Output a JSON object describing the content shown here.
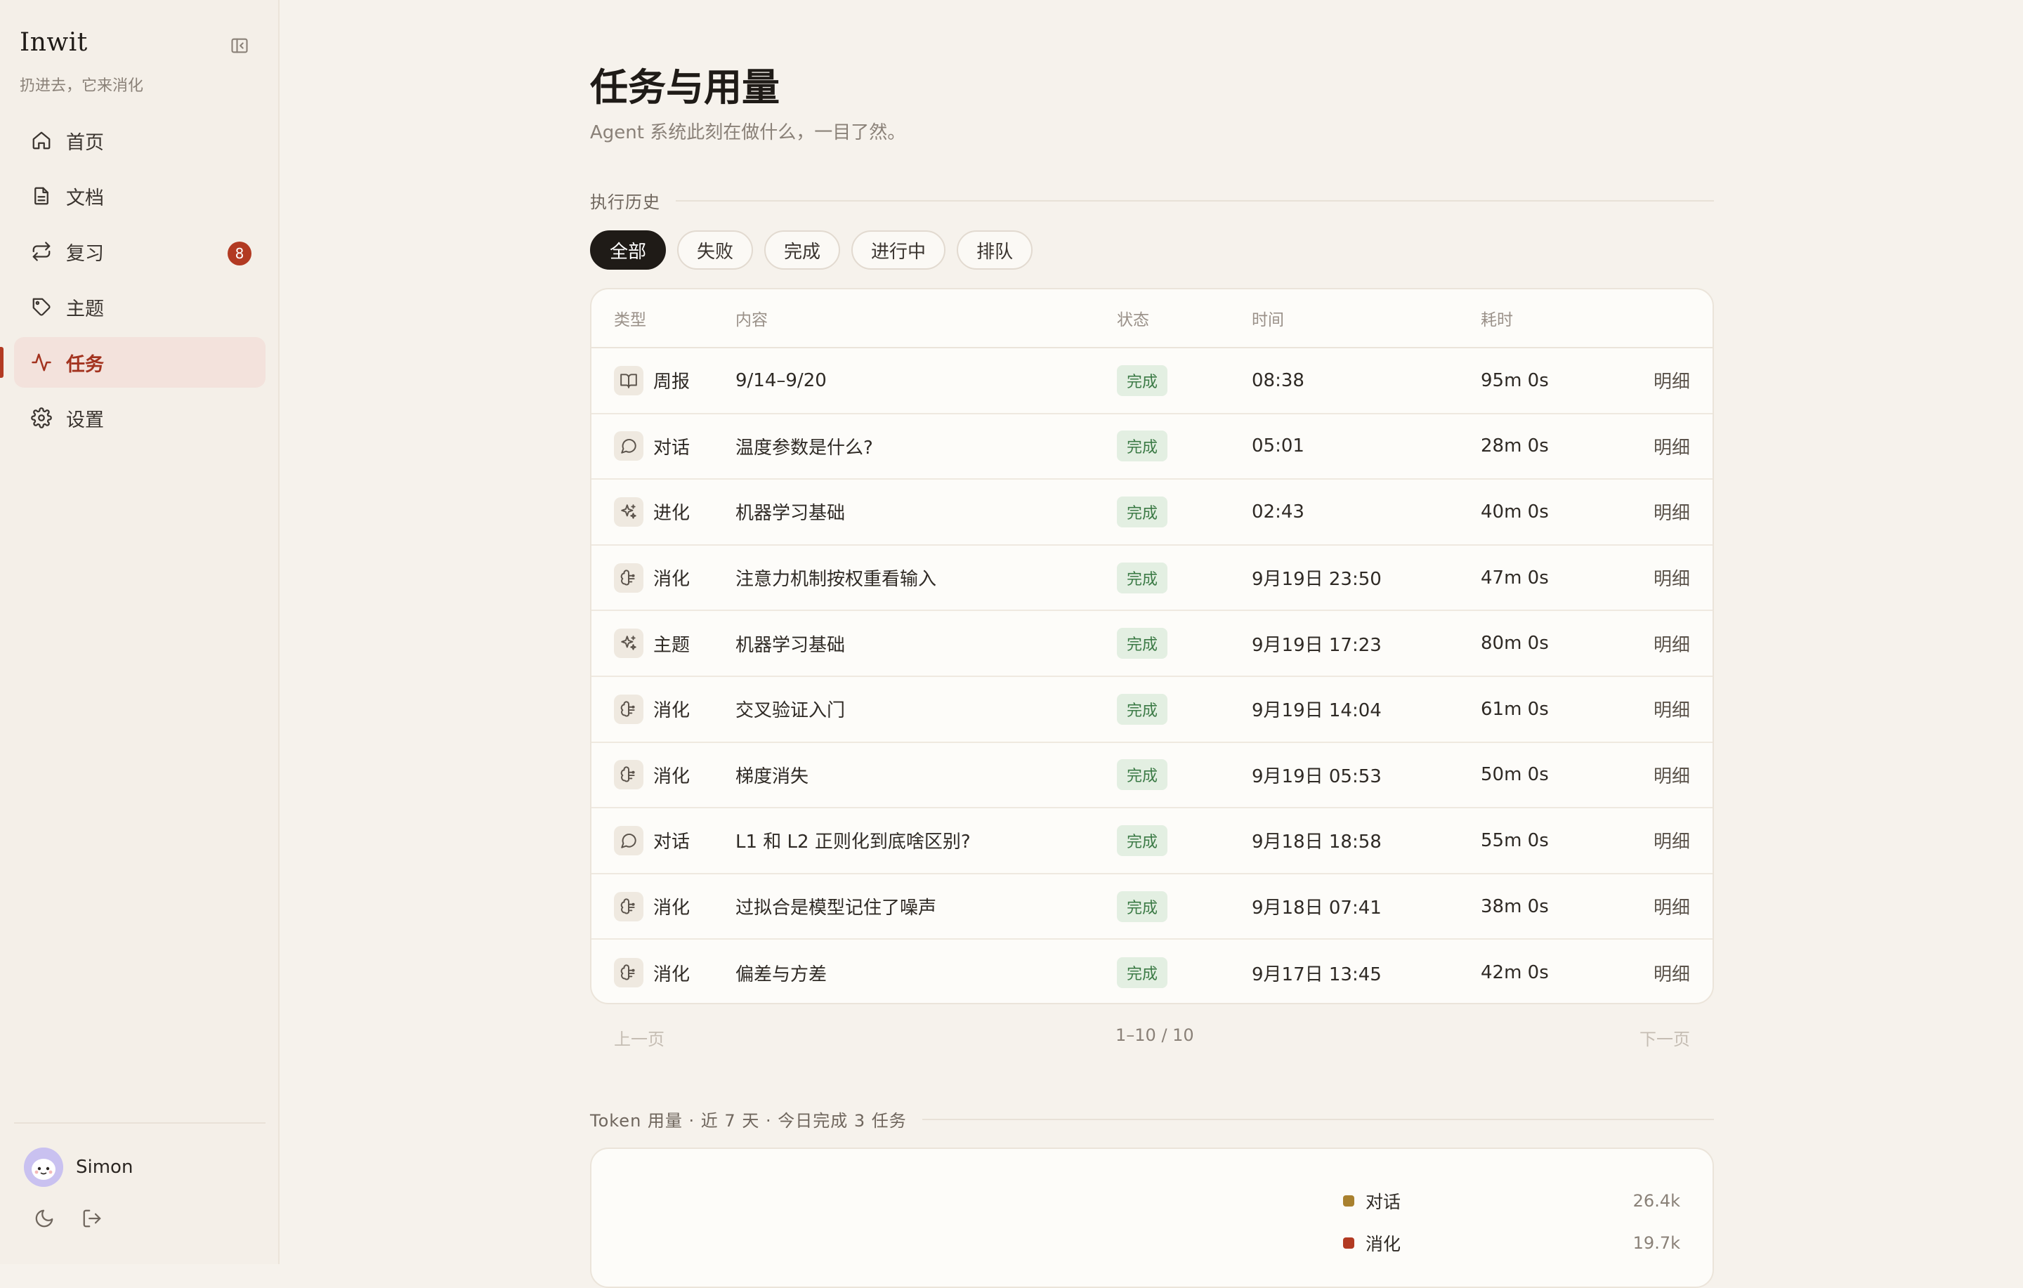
{
  "sidebar": {
    "brand": "Inwit",
    "tagline": "扔进去，它来消化",
    "nav": [
      {
        "label": "首页",
        "icon": "home-icon"
      },
      {
        "label": "文档",
        "icon": "document-icon"
      },
      {
        "label": "复习",
        "icon": "repeat-icon",
        "badge": "8"
      },
      {
        "label": "主题",
        "icon": "tag-icon"
      },
      {
        "label": "任务",
        "icon": "activity-icon",
        "active": true
      },
      {
        "label": "设置",
        "icon": "gear-icon"
      }
    ],
    "user": {
      "name": "Simon"
    }
  },
  "main": {
    "title": "任务与用量",
    "subtitle": "Agent 系统此刻在做什么，一目了然。",
    "history_label": "执行历史",
    "filters": [
      "全部",
      "失败",
      "完成",
      "进行中",
      "排队"
    ],
    "table": {
      "headers": {
        "type": "类型",
        "content": "内容",
        "status": "状态",
        "time": "时间",
        "duration": "耗时"
      },
      "rows": [
        {
          "type": "周报",
          "icon": "book-icon",
          "content": "9/14–9/20",
          "status": "完成",
          "time": "08:38",
          "duration": "95m 0s",
          "action": "明细"
        },
        {
          "type": "对话",
          "icon": "chat-icon",
          "content": "温度参数是什么?",
          "status": "完成",
          "time": "05:01",
          "duration": "28m 0s",
          "action": "明细"
        },
        {
          "type": "进化",
          "icon": "sparkle-icon",
          "content": "机器学习基础",
          "status": "完成",
          "time": "02:43",
          "duration": "40m 0s",
          "action": "明细"
        },
        {
          "type": "消化",
          "icon": "digest-icon",
          "content": "注意力机制按权重看输入",
          "status": "完成",
          "time": "9月19日 23:50",
          "duration": "47m 0s",
          "action": "明细"
        },
        {
          "type": "主题",
          "icon": "sparkle-icon",
          "content": "机器学习基础",
          "status": "完成",
          "time": "9月19日 17:23",
          "duration": "80m 0s",
          "action": "明细"
        },
        {
          "type": "消化",
          "icon": "digest-icon",
          "content": "交叉验证入门",
          "status": "完成",
          "time": "9月19日 14:04",
          "duration": "61m 0s",
          "action": "明细"
        },
        {
          "type": "消化",
          "icon": "digest-icon",
          "content": "梯度消失",
          "status": "完成",
          "time": "9月19日 05:53",
          "duration": "50m 0s",
          "action": "明细"
        },
        {
          "type": "对话",
          "icon": "chat-icon",
          "content": "L1 和 L2 正则化到底啥区别?",
          "status": "完成",
          "time": "9月18日 18:58",
          "duration": "55m 0s",
          "action": "明细"
        },
        {
          "type": "消化",
          "icon": "digest-icon",
          "content": "过拟合是模型记住了噪声",
          "status": "完成",
          "time": "9月18日 07:41",
          "duration": "38m 0s",
          "action": "明细"
        },
        {
          "type": "消化",
          "icon": "digest-icon",
          "content": "偏差与方差",
          "status": "完成",
          "time": "9月17日 13:45",
          "duration": "42m 0s",
          "action": "明细"
        }
      ]
    },
    "pager": {
      "prev": "上一页",
      "info": "1–10 / 10",
      "next": "下一页"
    },
    "usage_label": "Token 用量 · 近 7 天 · 今日完成 3 任务",
    "usage_legend": [
      {
        "label": "对话",
        "value": "26.4k",
        "color": "#a9812f"
      },
      {
        "label": "消化",
        "value": "19.7k",
        "color": "#b23a22"
      }
    ]
  }
}
